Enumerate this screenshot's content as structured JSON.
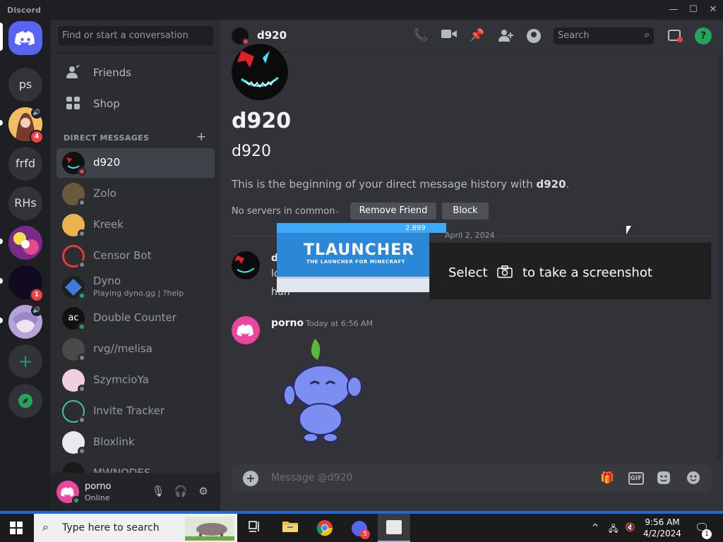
{
  "window": {
    "app_name": "Discord",
    "minimize": "—",
    "maximize": "☐",
    "close": "✕"
  },
  "rail": {
    "servers": [
      {
        "label": "ps"
      },
      {
        "label": "frfd"
      },
      {
        "label": "RHs"
      }
    ],
    "badges": {
      "server2": "4",
      "server6": "1"
    }
  },
  "sidebar": {
    "search_placeholder": "Find or start a conversation",
    "nav": [
      {
        "label": "Friends"
      },
      {
        "label": "Shop"
      }
    ],
    "dm_header": "DIRECT MESSAGES",
    "dm_add": "+",
    "dms": [
      {
        "name": "d920",
        "status": "dnd"
      },
      {
        "name": "Zolo",
        "status": "offline"
      },
      {
        "name": "Kreek",
        "status": "offline"
      },
      {
        "name": "Censor Bot",
        "status": "offline"
      },
      {
        "name": "Dyno",
        "subtitle": "Playing dyno.gg | ?help",
        "status": "online"
      },
      {
        "name": "Double Counter",
        "status": "online"
      },
      {
        "name": "rvg//melisa",
        "status": "offline"
      },
      {
        "name": "SzymcioYa",
        "status": "offline"
      },
      {
        "name": "Invite Tracker",
        "status": "offline"
      },
      {
        "name": "Bloxlink",
        "status": "offline"
      },
      {
        "name": "MWNODES",
        "status": "offline"
      }
    ]
  },
  "user": {
    "name": "porno",
    "status": "Online"
  },
  "header": {
    "channel_name": "d920",
    "search_placeholder": "Search",
    "help": "?"
  },
  "welcome": {
    "title": "d920",
    "subtitle": "d920",
    "intro_prefix": "This is the beginning of your direct message history with ",
    "intro_name": "d920",
    "intro_suffix": ".",
    "common": "No servers in common",
    "remove_friend": "Remove Friend",
    "block": "Block"
  },
  "date_divider": "April 2, 2024",
  "messages": [
    {
      "author": "d",
      "lines": [
        "lo",
        "huh"
      ]
    },
    {
      "author": "porno",
      "timestamp": "Today at 6:56 AM"
    }
  ],
  "composer": {
    "placeholder": "Message @d920",
    "gif": "GIF"
  },
  "overlay": {
    "tlauncher_version": "2.899",
    "tlauncher_title": "TLAUNCHER",
    "tlauncher_tagline": "THE LAUNCHER FOR MINECRAFT",
    "toast_pre": "Select",
    "toast_post": "to take a screenshot"
  },
  "taskbar": {
    "search_placeholder": "Type here to search",
    "time": "9:56 AM",
    "date": "4/2/2024",
    "notif_count": "1",
    "app_badge": "5"
  },
  "colors": {
    "blurple": "#5865f2",
    "online": "#23a55a",
    "dnd": "#f23f43",
    "bg": "#313338"
  }
}
